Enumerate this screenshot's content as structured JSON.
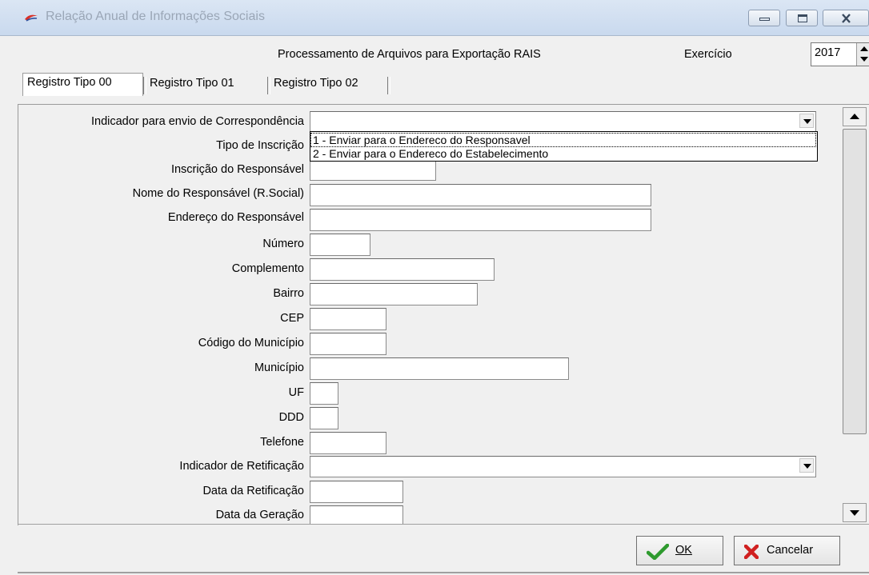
{
  "window": {
    "title": "Relação Anual de Informações Sociais",
    "icons": {
      "app": "red-swoosh-icon",
      "minimize": "minimize-icon",
      "maximize": "maximize-icon",
      "close": "close-icon"
    }
  },
  "header": {
    "title": "Processamento de Arquivos para Exportação RAIS",
    "exercicio_label": "Exercício",
    "exercicio_value": "2017"
  },
  "tabs": [
    {
      "label": "Registro Tipo 00",
      "active": true
    },
    {
      "label": "Registro Tipo 01",
      "active": false
    },
    {
      "label": "Registro Tipo 02",
      "active": false
    }
  ],
  "form": {
    "fields": [
      {
        "label": "Indicador para envio de Correspondência",
        "value": "",
        "kind": "combo"
      },
      {
        "label": "Tipo de Inscrição",
        "value": "",
        "kind": "text"
      },
      {
        "label": "Inscrição do Responsável",
        "value": "",
        "kind": "text"
      },
      {
        "label": "Nome do Responsável (R.Social)",
        "value": "",
        "kind": "text"
      },
      {
        "label": "Endereço do Responsável",
        "value": "",
        "kind": "text"
      },
      {
        "label": "Número",
        "value": "",
        "kind": "text"
      },
      {
        "label": "Complemento",
        "value": "",
        "kind": "text"
      },
      {
        "label": "Bairro",
        "value": "",
        "kind": "text"
      },
      {
        "label": "CEP",
        "value": "",
        "kind": "text"
      },
      {
        "label": "Código do Município",
        "value": "",
        "kind": "text"
      },
      {
        "label": "Município",
        "value": "",
        "kind": "text"
      },
      {
        "label": "UF",
        "value": "",
        "kind": "text"
      },
      {
        "label": "DDD",
        "value": "",
        "kind": "text"
      },
      {
        "label": "Telefone",
        "value": "",
        "kind": "text"
      },
      {
        "label": "Indicador de Retificação",
        "value": "",
        "kind": "combo"
      },
      {
        "label": "Data da Retificação",
        "value": "",
        "kind": "text"
      },
      {
        "label": "Data da Geração",
        "value": "",
        "kind": "text"
      }
    ],
    "dropdown_open_options": [
      "1 - Enviar para o Endereco do Responsavel",
      "2 - Enviar para o Endereco do Estabelecimento"
    ],
    "dropdown_highlighted_index": 0
  },
  "footer": {
    "ok_label": "OK",
    "cancel_label": "Cancelar",
    "icons": {
      "ok": "green-checkmark-icon",
      "cancel": "red-x-icon"
    }
  }
}
